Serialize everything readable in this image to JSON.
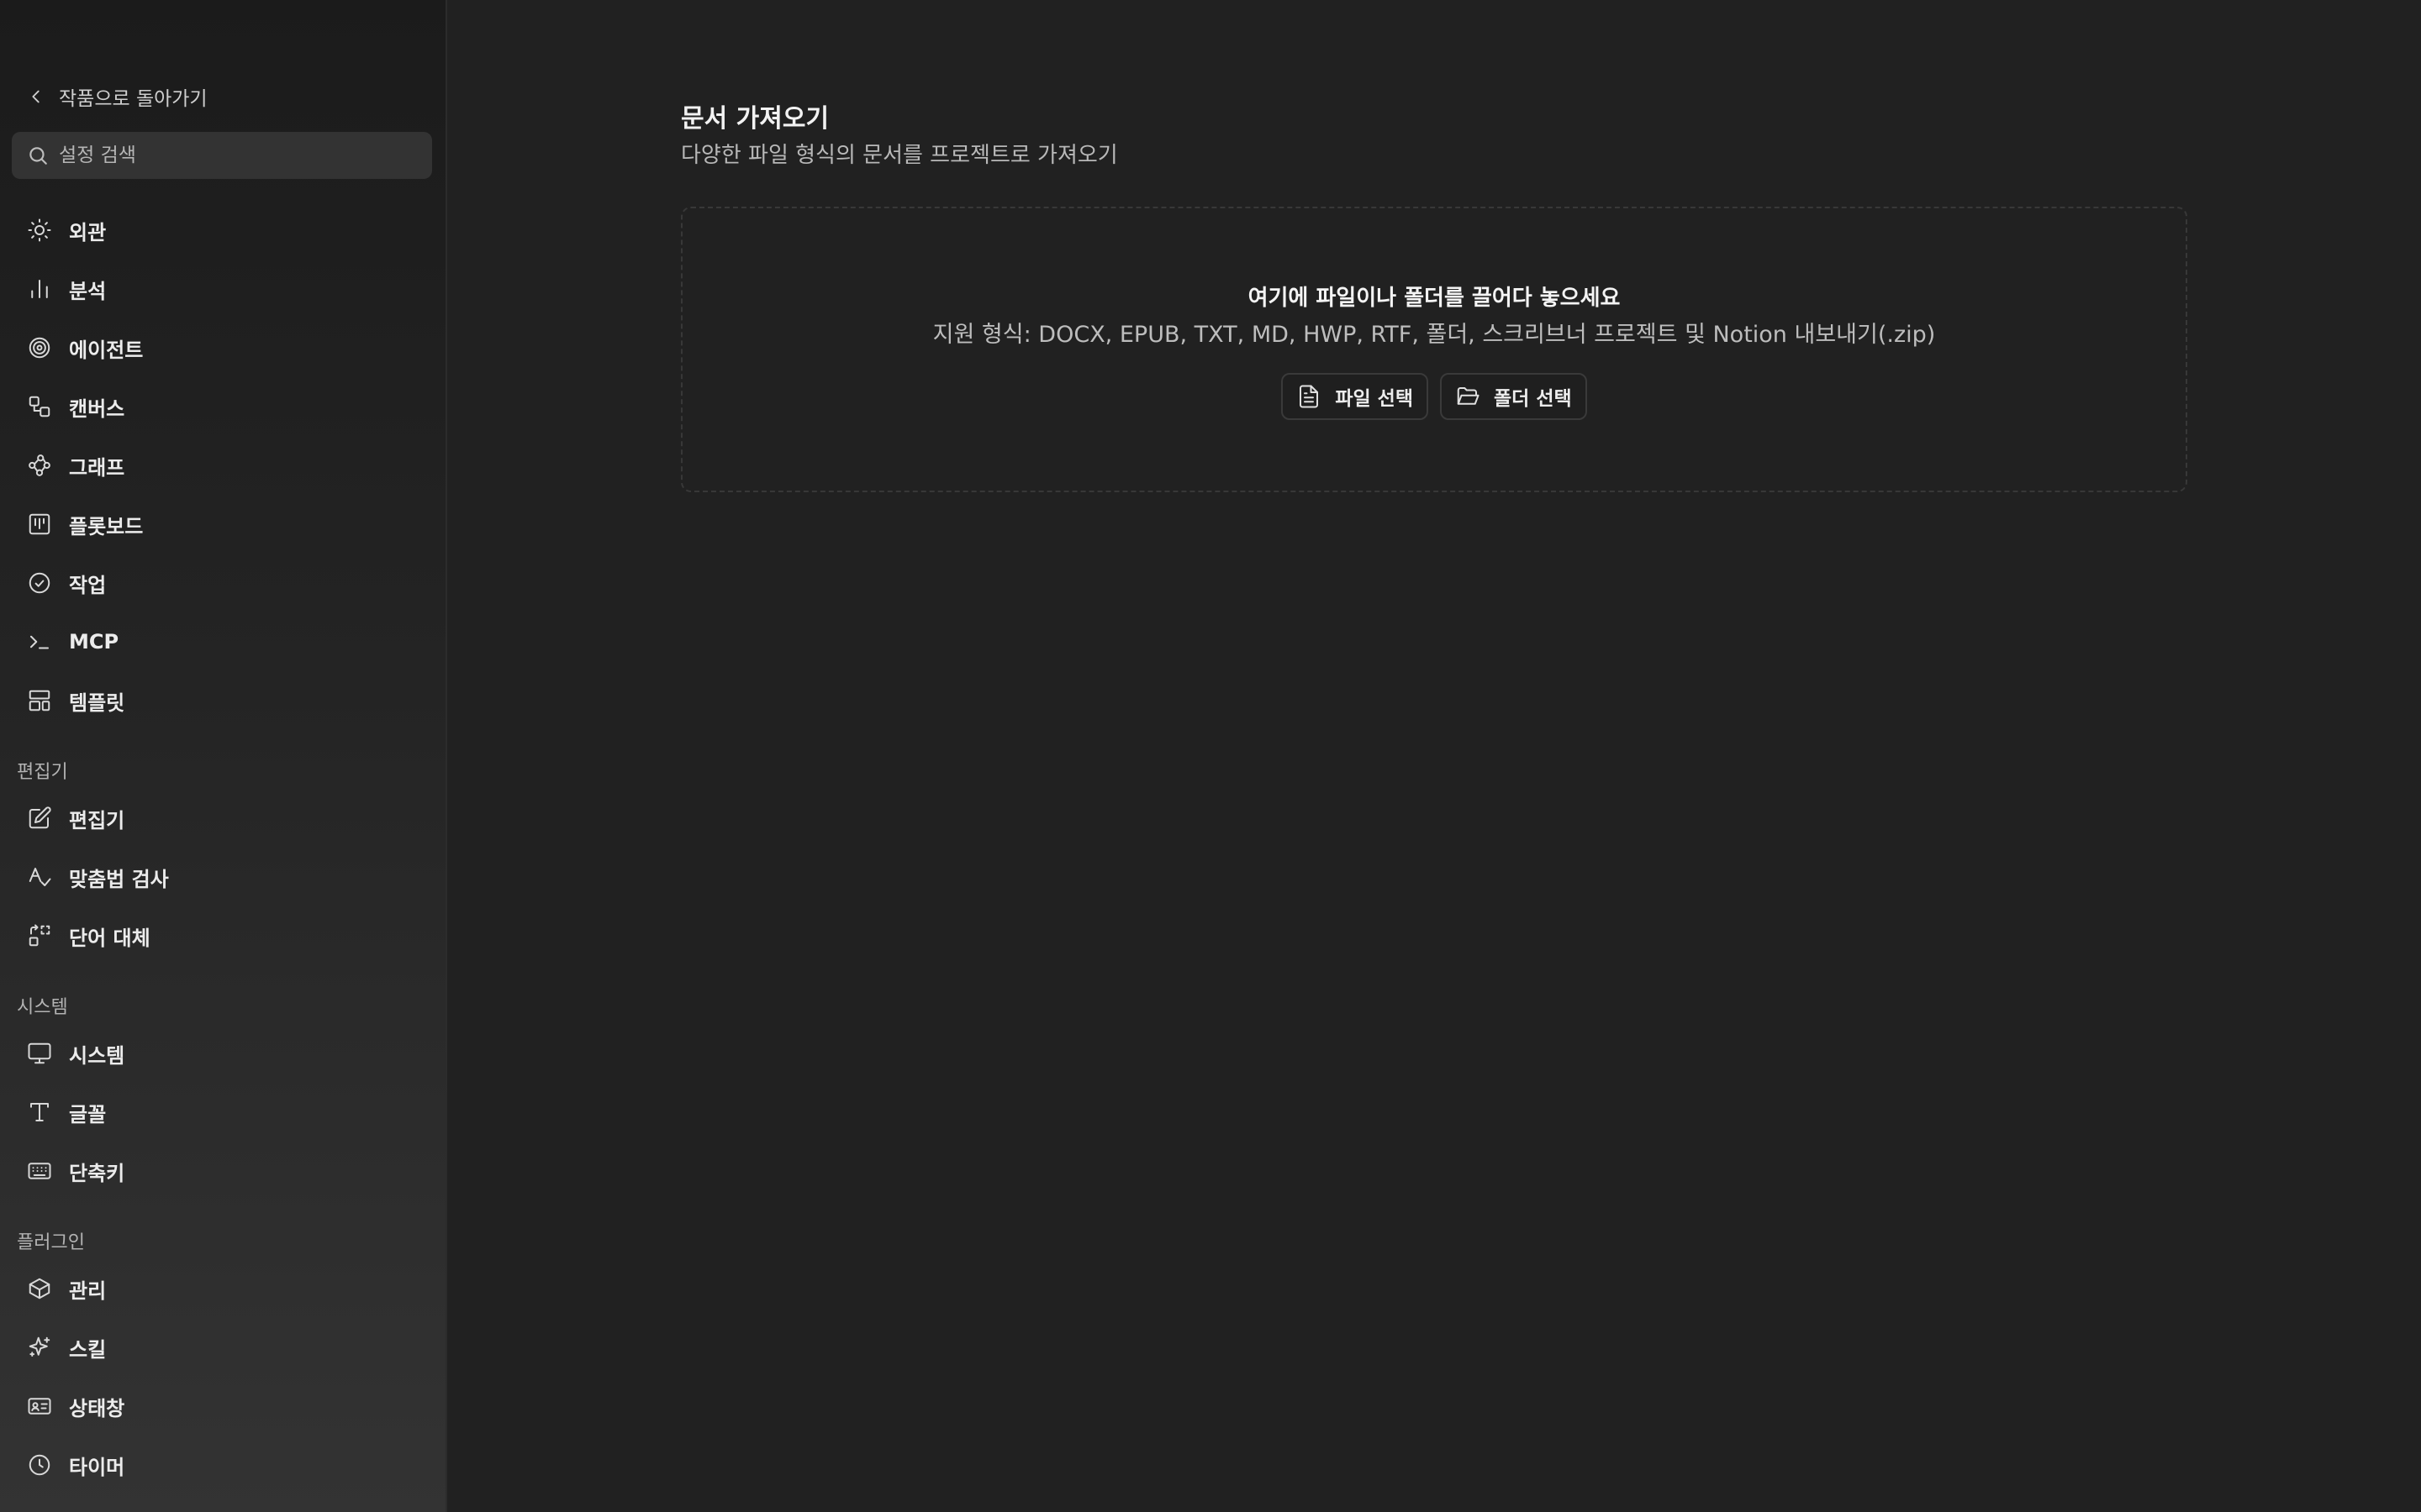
{
  "sidebar": {
    "back_label": "작품으로 돌아가기",
    "search_placeholder": "설정 검색",
    "items": [
      {
        "label": "외관",
        "icon": "sun-icon"
      },
      {
        "label": "분석",
        "icon": "bar-chart-icon"
      },
      {
        "label": "에이전트",
        "icon": "spiral-icon"
      },
      {
        "label": "캔버스",
        "icon": "shapes-icon"
      },
      {
        "label": "그래프",
        "icon": "graph-nodes-icon"
      },
      {
        "label": "플롯보드",
        "icon": "kanban-icon"
      },
      {
        "label": "작업",
        "icon": "check-circle-icon"
      },
      {
        "label": "MCP",
        "icon": "terminal-icon"
      },
      {
        "label": "템플릿",
        "icon": "layout-template-icon"
      }
    ],
    "sections": [
      {
        "title": "편집기",
        "items": [
          {
            "label": "편집기",
            "icon": "edit-icon"
          },
          {
            "label": "맞춤법 검사",
            "icon": "spell-check-icon"
          },
          {
            "label": "단어 대체",
            "icon": "replace-icon"
          }
        ]
      },
      {
        "title": "시스템",
        "items": [
          {
            "label": "시스템",
            "icon": "monitor-icon"
          },
          {
            "label": "글꼴",
            "icon": "type-icon"
          },
          {
            "label": "단축키",
            "icon": "keyboard-icon"
          }
        ]
      },
      {
        "title": "플러그인",
        "items": [
          {
            "label": "관리",
            "icon": "package-icon"
          },
          {
            "label": "스킬",
            "icon": "sparkle-icon"
          },
          {
            "label": "상태창",
            "icon": "id-card-icon"
          },
          {
            "label": "타이머",
            "icon": "clock-icon"
          }
        ]
      }
    ]
  },
  "main": {
    "title": "문서 가져오기",
    "subtitle": "다양한 파일 형식의 문서를 프로젝트로 가져오기",
    "dropzone": {
      "title": "여기에 파일이나 폴더를 끌어다 놓으세요",
      "formats": "지원 형식: DOCX, EPUB, TXT, MD, HWP, RTF, 폴더, 스크리브너 프로젝트 및 Notion 내보내기(.zip)",
      "file_button": "파일 선택",
      "folder_button": "폴더 선택"
    }
  },
  "colors": {
    "background": "#212121",
    "sidebar_top": "#1b1b1b",
    "sidebar_bottom": "#333333",
    "text": "#e6e6e6",
    "muted_text": "#b8b8b8",
    "border": "#383838"
  }
}
